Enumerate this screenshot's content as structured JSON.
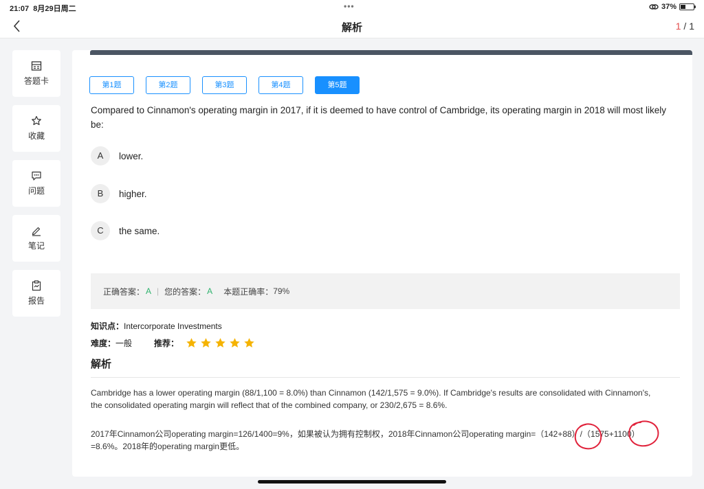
{
  "status": {
    "time": "21:07",
    "date": "8月29日周二",
    "dots": "•••",
    "battery": "37%",
    "battery_fraction": 0.37
  },
  "nav": {
    "title": "解析",
    "page_current": "1",
    "page_total": "/ 1"
  },
  "sidebar": {
    "items": [
      {
        "label": "答题卡",
        "icon": "answer-sheet-icon"
      },
      {
        "label": "收藏",
        "icon": "star-icon"
      },
      {
        "label": "问题",
        "icon": "message-icon"
      },
      {
        "label": "笔记",
        "icon": "pen-icon"
      },
      {
        "label": "报告",
        "icon": "clipboard-icon"
      }
    ]
  },
  "tabs": [
    {
      "label": "第1题"
    },
    {
      "label": "第2题"
    },
    {
      "label": "第3题"
    },
    {
      "label": "第4题"
    },
    {
      "label": "第5题"
    }
  ],
  "active_tab_index": 4,
  "question": {
    "text": "Compared to Cinnamon's operating margin in 2017, if it is deemed to have control of Cambridge, its operating margin in 2018 will most likely be:",
    "options": [
      {
        "letter": "A",
        "text": "lower."
      },
      {
        "letter": "B",
        "text": "higher."
      },
      {
        "letter": "C",
        "text": "the same."
      }
    ]
  },
  "answer": {
    "correct_label": "正确答案：",
    "correct_value": "A",
    "separator": "|",
    "yours_label": "您的答案：",
    "yours_value": "A",
    "rate_label": "本题正确率：",
    "rate_value": "79%"
  },
  "meta": {
    "knowledge_label": "知识点：",
    "knowledge_value": "Intercorporate Investments",
    "difficulty_label": "难度：",
    "difficulty_value": "一般",
    "recommend_label": "推荐：",
    "recommend_stars": 5
  },
  "analysis": {
    "title": "解析",
    "para1": "Cambridge has a lower operating margin (88/1,100 = 8.0%) than Cinnamon (142/1,575 = 9.0%). If Cambridge's results are consolidated with Cinnamon's, the consolidated operating margin will reflect that of the combined company, or 230/2,675 = 8.6%.",
    "para2": "2017年Cinnamon公司operating margin=126/1400=9%，如果被认为拥有控制权，2018年Cinnamon公司operating margin=（142+88）/（1575+1100）=8.6%。2018年的operating margin更低。"
  },
  "colors": {
    "accent": "#1890ff",
    "correct": "#2fb36e",
    "star": "#f5b301",
    "annotation": "#e0213a",
    "page_current": "#e34d4d"
  }
}
